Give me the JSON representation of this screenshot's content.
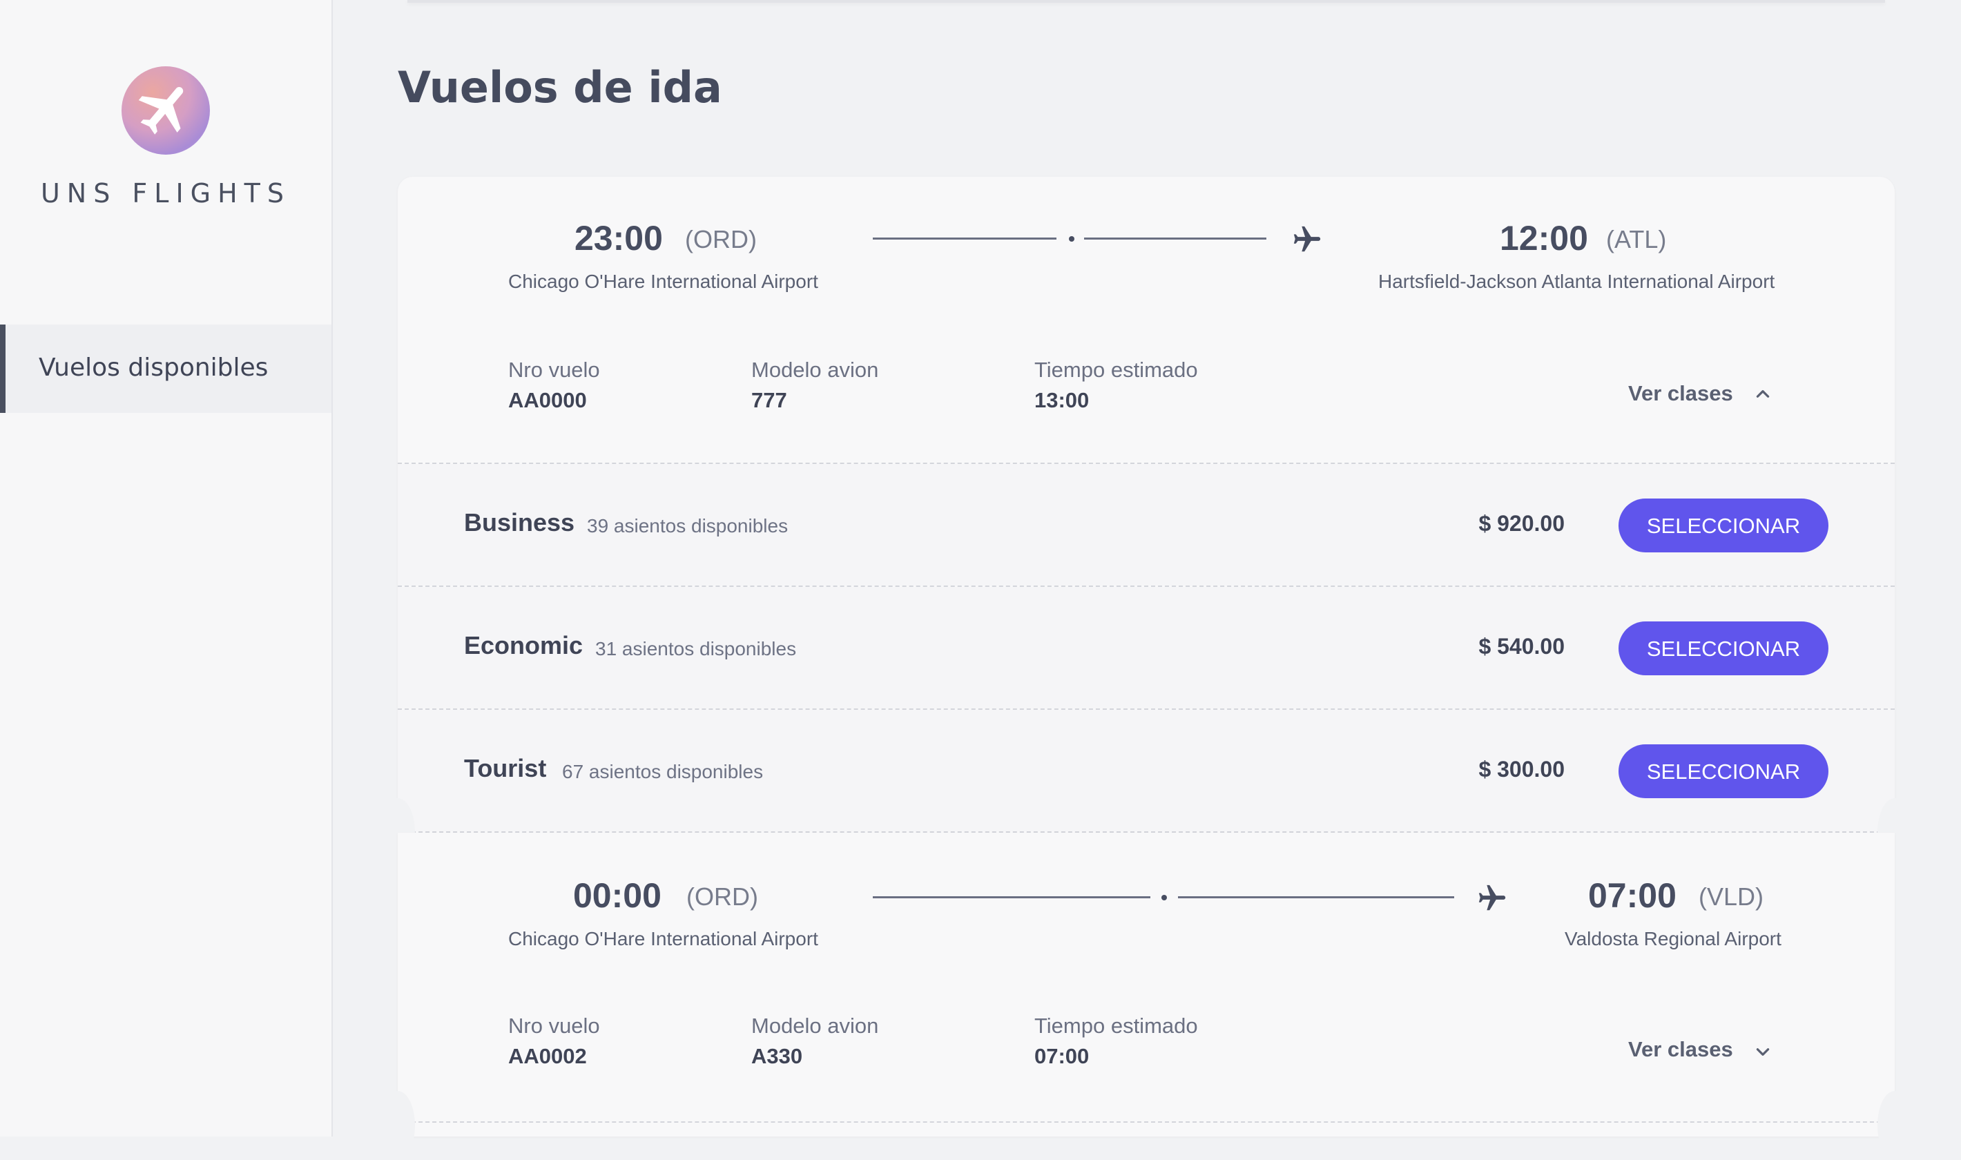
{
  "sidebar": {
    "brand": "UNS FLIGHTS",
    "nav": [
      {
        "label": "Vuelos disponibles",
        "active": true
      }
    ]
  },
  "page": {
    "title": "Vuelos de ida"
  },
  "colors": {
    "accent": "#6055ec",
    "text": "#454b5e",
    "background": "#f1f2f4"
  },
  "flights": [
    {
      "departure_time": "23:00",
      "departure_code": "(ORD)",
      "departure_airport": "Chicago O'Hare International Airport",
      "arrival_time": "12:00",
      "arrival_code": "(ATL)",
      "arrival_airport": "Hartsfield-Jackson Atlanta International Airport",
      "flight_no_label": "Nro vuelo",
      "flight_no": "AA0000",
      "model_label": "Modelo avion",
      "model": "777",
      "duration_label": "Tiempo estimado",
      "duration": "13:00",
      "toggle_label": "Ver clases",
      "expanded": true,
      "classes": [
        {
          "name": "Business",
          "seats": "39 asientos disponibles",
          "price": "$ 920.00",
          "button": "SELECCIONAR"
        },
        {
          "name": "Economic",
          "seats": "31 asientos disponibles",
          "price": "$ 540.00",
          "button": "SELECCIONAR"
        },
        {
          "name": "Tourist",
          "seats": "67 asientos disponibles",
          "price": "$ 300.00",
          "button": "SELECCIONAR"
        }
      ]
    },
    {
      "departure_time": "00:00",
      "departure_code": "(ORD)",
      "departure_airport": "Chicago O'Hare International Airport",
      "arrival_time": "07:00",
      "arrival_code": "(VLD)",
      "arrival_airport": "Valdosta Regional Airport",
      "flight_no_label": "Nro vuelo",
      "flight_no": "AA0002",
      "model_label": "Modelo avion",
      "model": "A330",
      "duration_label": "Tiempo estimado",
      "duration": "07:00",
      "toggle_label": "Ver clases",
      "expanded": false
    }
  ]
}
